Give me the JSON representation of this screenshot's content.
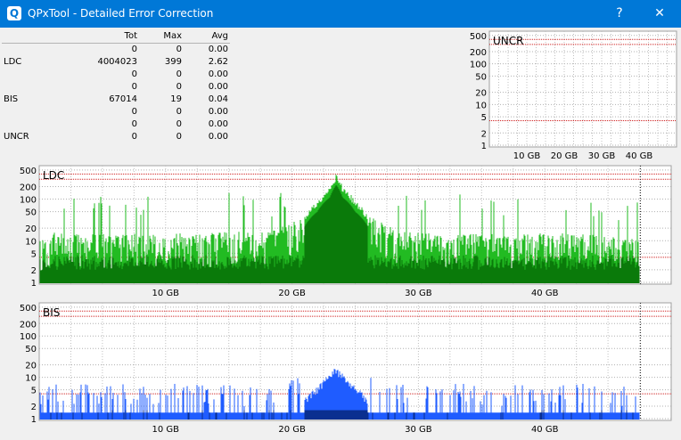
{
  "window": {
    "title": "QPxTool - Detailed Error Correction",
    "app_icon": "Q",
    "help_label": "?",
    "close_label": "✕"
  },
  "stats": {
    "headers": [
      "Tot",
      "Max",
      "Avg"
    ],
    "rows": [
      {
        "label": "",
        "tot": "0",
        "max": "0",
        "avg": "0.00"
      },
      {
        "label": "LDC",
        "tot": "4004023",
        "max": "399",
        "avg": "2.62"
      },
      {
        "label": "",
        "tot": "0",
        "max": "0",
        "avg": "0.00"
      },
      {
        "label": "",
        "tot": "0",
        "max": "0",
        "avg": "0.00"
      },
      {
        "label": "BIS",
        "tot": "67014",
        "max": "19",
        "avg": "0.04"
      },
      {
        "label": "",
        "tot": "0",
        "max": "0",
        "avg": "0.00"
      },
      {
        "label": "",
        "tot": "0",
        "max": "0",
        "avg": "0.00"
      },
      {
        "label": "UNCR",
        "tot": "0",
        "max": "0",
        "avg": "0.00"
      }
    ]
  },
  "colors": {
    "ldc_light": "#22bb22",
    "ldc_dark": "#0a7a0a",
    "bis": "#1f5cff",
    "bis_dark": "#0a2f90",
    "threshold_red": "#d02020"
  },
  "chart_data": [
    {
      "type": "bar",
      "title": "UNCR",
      "yscale": "log",
      "yticks": [
        "500",
        "200",
        "100",
        "50",
        "20",
        "10",
        "5",
        "2",
        "1"
      ],
      "xticks": [
        "10 GB",
        "20 GB",
        "30 GB",
        "40 GB"
      ],
      "xlim": [
        0,
        50
      ],
      "ylim": [
        1,
        500
      ],
      "values": []
    },
    {
      "type": "bar",
      "title": "LDC",
      "yscale": "log",
      "yticks": [
        "500",
        "200",
        "100",
        "50",
        "20",
        "10",
        "5",
        "2",
        "1"
      ],
      "xticks": [
        "10 GB",
        "20 GB",
        "30 GB",
        "40 GB"
      ],
      "xlim": [
        0,
        50
      ],
      "ylim": [
        1,
        500
      ],
      "max": 399,
      "peak_position_gb": 23.5,
      "data_end_gb": 47.5,
      "series": [
        {
          "x": [
            1,
            3,
            5,
            7,
            9,
            11,
            13,
            15,
            17,
            19,
            21,
            22,
            23,
            23.5,
            24,
            25,
            26,
            28,
            30,
            32,
            34,
            36,
            38,
            40,
            42,
            44,
            46,
            47.5
          ],
          "values": [
            15,
            14,
            14,
            15,
            14,
            15,
            14,
            16,
            15,
            18,
            40,
            90,
            200,
            399,
            200,
            90,
            40,
            18,
            15,
            14,
            15,
            14,
            14,
            15,
            14,
            13,
            12,
            10
          ]
        }
      ]
    },
    {
      "type": "bar",
      "title": "BIS",
      "yscale": "log",
      "yticks": [
        "500",
        "200",
        "100",
        "50",
        "20",
        "10",
        "5",
        "2",
        "1"
      ],
      "xticks": [
        "10 GB",
        "20 GB",
        "30 GB",
        "40 GB"
      ],
      "xlim": [
        0,
        50
      ],
      "ylim": [
        1,
        500
      ],
      "max": 19,
      "peak_position_gb": 23.5,
      "data_end_gb": 47.5,
      "series": [
        {
          "x": [
            1,
            3,
            5,
            7,
            9,
            11,
            13,
            15,
            17,
            19,
            21,
            22,
            23,
            23.5,
            24,
            25,
            26,
            28,
            30,
            32,
            34,
            36,
            38,
            40,
            42,
            44,
            46,
            47.5
          ],
          "values": [
            2,
            2,
            2,
            2,
            2,
            2,
            2,
            2,
            2,
            2,
            3,
            6,
            12,
            19,
            12,
            6,
            3,
            2,
            2,
            2,
            2,
            2,
            2,
            2,
            2,
            2,
            2,
            2
          ]
        }
      ]
    }
  ]
}
